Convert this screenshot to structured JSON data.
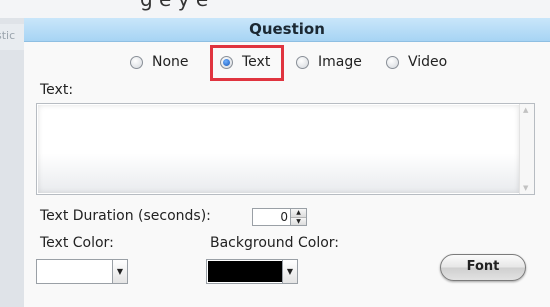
{
  "dialog": {
    "title": "Question"
  },
  "background": {
    "tab_fragment": "stic"
  },
  "media_type": {
    "options": [
      {
        "label": "None",
        "checked": false
      },
      {
        "label": "Text",
        "checked": true
      },
      {
        "label": "Image",
        "checked": false
      },
      {
        "label": "Video",
        "checked": false
      }
    ]
  },
  "text_section": {
    "label": "Text:",
    "value": ""
  },
  "duration": {
    "label": "Text Duration (seconds):",
    "value": "0"
  },
  "text_color": {
    "label": "Text Color:",
    "value": "#ffffff"
  },
  "background_color": {
    "label": "Background Color:",
    "value": "#000000"
  },
  "font_button": {
    "label": "Font"
  },
  "colors": {
    "highlight": "#e0343f",
    "header": "#b5dcf7"
  },
  "icons": {
    "dropdown": "chevron-down-icon",
    "spinner_up": "arrow-up-icon",
    "spinner_down": "arrow-down-icon"
  }
}
